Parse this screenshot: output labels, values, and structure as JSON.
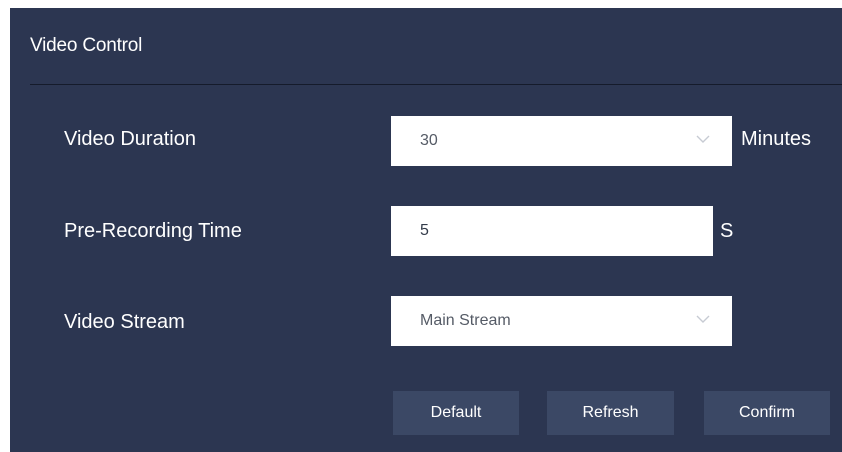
{
  "panel": {
    "title": "Video Control"
  },
  "form": {
    "video_duration": {
      "label": "Video Duration",
      "value": "30",
      "unit": "Minutes"
    },
    "pre_recording_time": {
      "label": "Pre-Recording Time",
      "value": "5",
      "unit": "S"
    },
    "video_stream": {
      "label": "Video Stream",
      "value": "Main Stream"
    }
  },
  "buttons": {
    "default": "Default",
    "refresh": "Refresh",
    "confirm": "Confirm"
  },
  "colors": {
    "panel_background": "#2c3651",
    "button_background": "#3b4865",
    "divider": "#151b2b",
    "field_background": "#ffffff"
  },
  "icons": {
    "dropdown": "chevron-down-icon"
  }
}
